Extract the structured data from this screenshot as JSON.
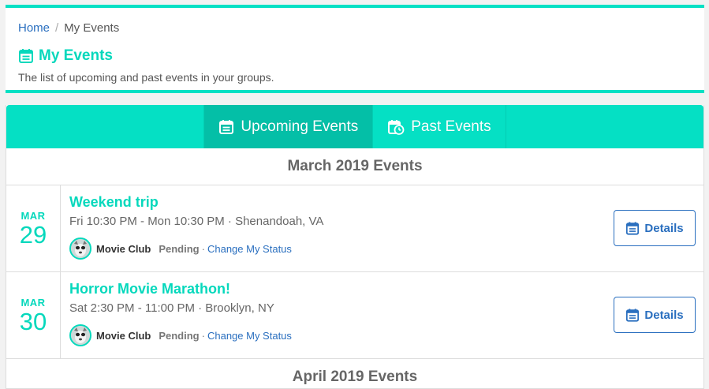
{
  "breadcrumb": {
    "home": "Home",
    "separator": "/",
    "current": "My Events"
  },
  "header": {
    "title": "My Events",
    "title_icon": "calendar-list-icon",
    "subtitle": "The list of upcoming and past events in your groups."
  },
  "tabs": [
    {
      "label": "Upcoming Events",
      "icon": "calendar-list-icon",
      "active": true
    },
    {
      "label": "Past Events",
      "icon": "calendar-clock-icon",
      "active": false
    }
  ],
  "months": [
    {
      "heading": "March 2019 Events",
      "events": [
        {
          "month": "MAR",
          "day": "29",
          "title": "Weekend trip",
          "meta": "Fri 10:30 PM - Mon 10:30 PM · Shenandoah, VA",
          "group": "Movie Club",
          "status": "Pending",
          "separator": "·",
          "change_status": "Change My Status",
          "details": "Details"
        },
        {
          "month": "MAR",
          "day": "30",
          "title": "Horror Movie Marathon!",
          "meta": "Sat 2:30 PM - 11:00 PM · Brooklyn, NY",
          "group": "Movie Club",
          "status": "Pending",
          "separator": "·",
          "change_status": "Change My Status",
          "details": "Details"
        }
      ]
    },
    {
      "heading": "April 2019 Events",
      "events": []
    }
  ],
  "colors": {
    "accent": "#05e0c4",
    "accent_dark": "#04bfa7",
    "link": "#2a6fbf"
  }
}
